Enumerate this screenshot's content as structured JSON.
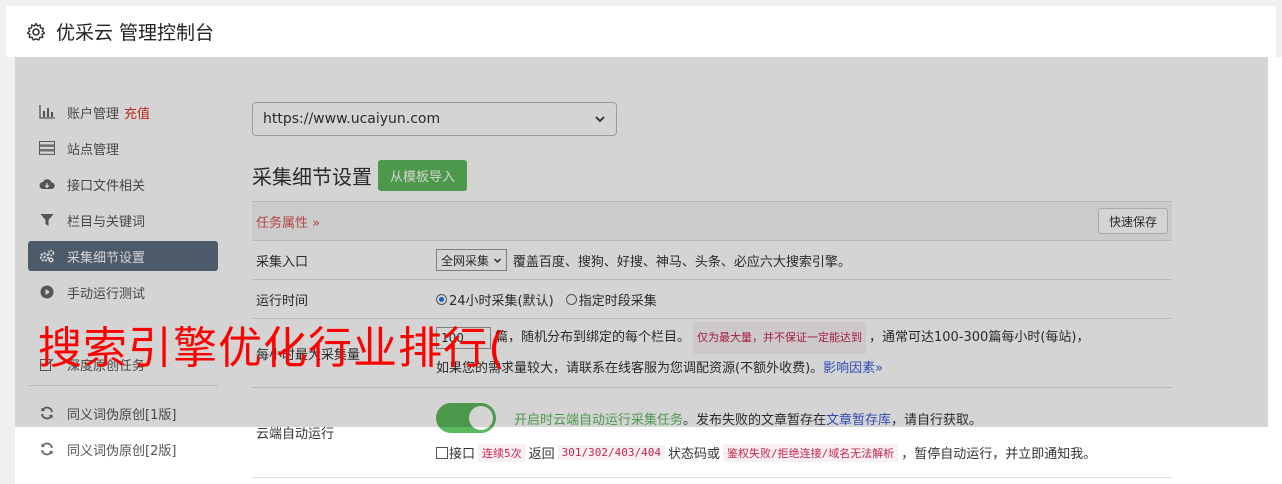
{
  "header": {
    "title": "优采云 管理控制台",
    "icon": "gear-icon"
  },
  "sidebar": {
    "items": [
      {
        "label": "账户管理",
        "tag": "充值",
        "icon": "bar-chart-icon"
      },
      {
        "label": "站点管理",
        "icon": "server-icon"
      },
      {
        "label": "接口文件相关",
        "icon": "cloud-download-icon"
      },
      {
        "label": "栏目与关键词",
        "icon": "filter-icon"
      },
      {
        "label": "采集细节设置",
        "icon": "gears-icon",
        "active": true
      },
      {
        "label": "手动运行测试",
        "icon": "play-circle-icon"
      },
      {
        "label": "",
        "icon": "hidden-icon"
      },
      {
        "label": "深度原创任务",
        "icon": "edit-icon"
      },
      {
        "label": "同义词伪原创[1版]",
        "icon": "refresh-icon"
      },
      {
        "label": "同义词伪原创[2版]",
        "icon": "refresh-icon"
      }
    ]
  },
  "main": {
    "site_select": "https://www.ucaiyun.com",
    "section_title": "采集细节设置",
    "import_button": "从模板导入",
    "task_attr": "任务属性",
    "quick_save": "快速保存",
    "rows": {
      "entry": {
        "label": "采集入口",
        "select": "全网采集",
        "desc": "覆盖百度、搜狗、好搜、神马、头条、必应六大搜索引擎。"
      },
      "time": {
        "label": "运行时间",
        "opt1": "24小时采集(默认)",
        "opt2": "指定时段采集"
      },
      "max": {
        "label": "每小时最大采集量",
        "value": "100",
        "text1": "篇，随机分布到绑定的每个栏目。",
        "code1": "仅为最大量，并不保证一定能达到",
        "text2": "，通常可达100-300篇每小时(每站)，",
        "text3": "如果您的需求量较大，请联系在线客服为您调配资源(不额外收费)。",
        "link": "影响因素"
      },
      "cloud": {
        "label": "云端自动运行",
        "toggle_text": "开启时云端自动运行采集任务",
        "text1": "。发布失败的文章暂存在",
        "link": "文章暂存库",
        "text2": "，请自行获取。",
        "chk_label": "接口",
        "code1": "连续5次",
        "text3": "返回",
        "code2": "301/302/403/404",
        "text4": "状态码或",
        "code3": "鉴权失败/拒绝连接/域名无法解析",
        "text5": "，暂停自动运行，并立即通知我。"
      }
    }
  },
  "watermark": "搜索引擎优化行业排行(",
  "colors": {
    "active_bg": "#5d6d80",
    "green": "#5cb85c",
    "red": "#e0342b",
    "watermark": "#ff0000"
  }
}
